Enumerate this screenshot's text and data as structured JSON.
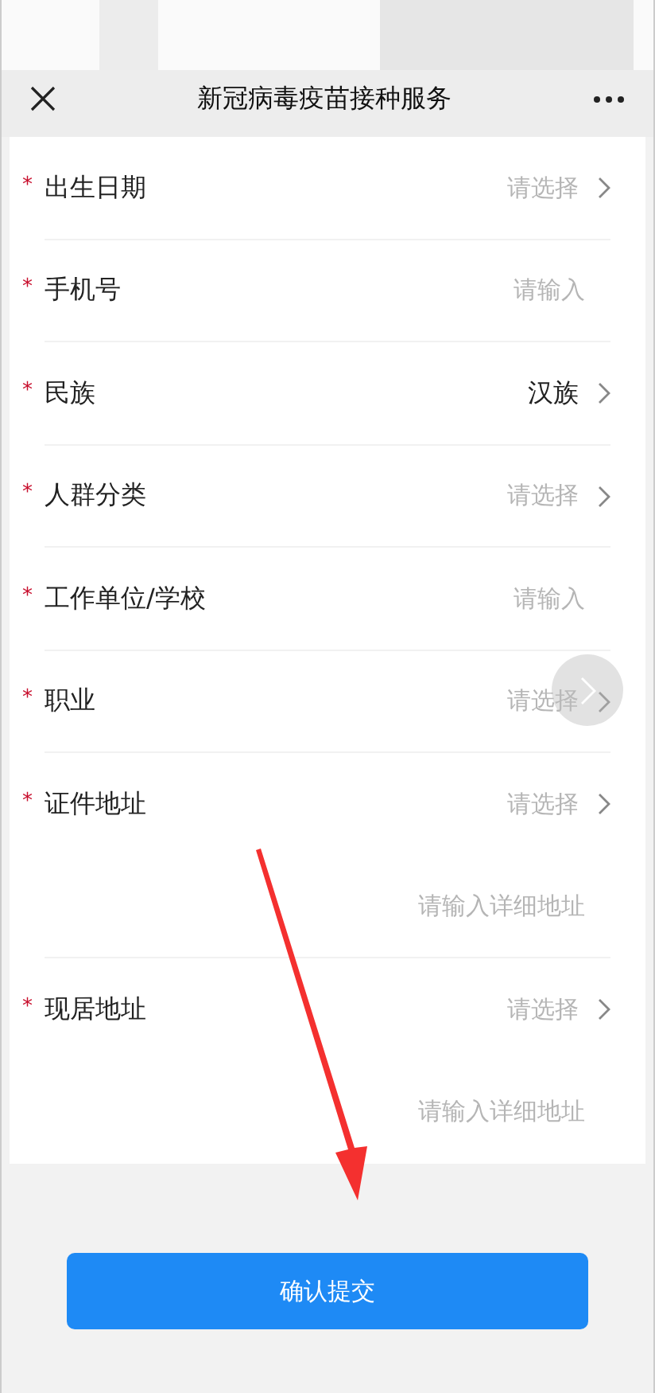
{
  "header": {
    "title": "新冠病毒疫苗接种服务"
  },
  "required_mark": "*",
  "fields": [
    {
      "kind": "select",
      "required": true,
      "label": "出生日期",
      "placeholder": "请选择"
    },
    {
      "kind": "input",
      "required": true,
      "label": "手机号",
      "placeholder": "请输入"
    },
    {
      "kind": "select",
      "required": true,
      "label": "民族",
      "value": "汉族"
    },
    {
      "kind": "select",
      "required": true,
      "label": "人群分类",
      "placeholder": "请选择"
    },
    {
      "kind": "input",
      "required": true,
      "label": "工作单位/学校",
      "placeholder": "请输入"
    },
    {
      "kind": "select",
      "required": true,
      "label": "职业",
      "placeholder": "请选择"
    },
    {
      "kind": "select",
      "required": true,
      "label": "证件地址",
      "placeholder": "请选择"
    },
    {
      "kind": "detail",
      "placeholder": "请输入详细地址"
    },
    {
      "kind": "select",
      "required": true,
      "label": "现居地址",
      "placeholder": "请选择"
    },
    {
      "kind": "detail",
      "placeholder": "请输入详细地址"
    }
  ],
  "submit_button": "确认提交"
}
